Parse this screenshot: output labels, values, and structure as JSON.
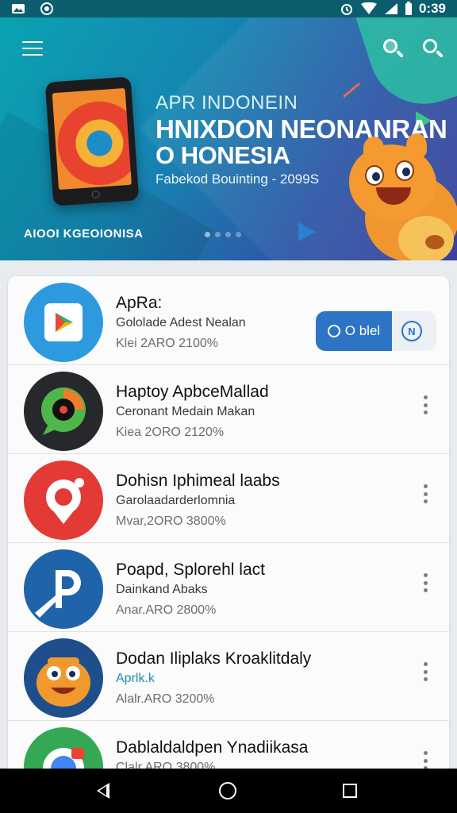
{
  "status_bar": {
    "time": "0:39",
    "icons": [
      "photo-icon",
      "circle-dot-icon",
      "alarm-icon",
      "wifi-icon",
      "signal-icon",
      "battery-icon"
    ]
  },
  "hero": {
    "kicker": "APR INDONEIN",
    "title_line1": "HNIXDON NEONANRAN",
    "title_line2": "O HONESIA",
    "subtitle": "Fabekod Bouinting - 2099S",
    "footer": "AIOOI KGEOIONISA",
    "carousel": {
      "count": 4,
      "active_index": 0
    },
    "colors": {
      "gradient_start": "#0aa3b1",
      "gradient_end": "#3b3f9b"
    }
  },
  "apps": [
    {
      "title": "ApRa:",
      "developer": "Gololade Adest Nealan",
      "meta": "Klei 2ARO 2100%",
      "icon": "play-store-icon",
      "action": {
        "install_label": "O blel",
        "alt_label": "N"
      }
    },
    {
      "title": "Haptoy ApbceMallad",
      "developer": "Ceronant Medain Makan",
      "meta": "Kiea 2ORO 2120%",
      "icon": "chat-bubble-icon"
    },
    {
      "title": "Dohisn Iphimeal laabs",
      "developer": "Garolaadarderlomnia",
      "meta": "Mvar,2ORO 3800%",
      "icon": "location-pin-icon"
    },
    {
      "title": "Poapd, Splorehl lact",
      "developer": "Dainkand Abaks",
      "meta": "Anar.ARO 2800%",
      "icon": "parking-icon"
    },
    {
      "title": "Dodan Iliplaks Kroaklitdaly",
      "developer": "Aprlk.k",
      "meta": "Alalr.ARO 3200%",
      "icon": "monster-mascot-icon"
    },
    {
      "title": "Dablaldaldpen Ynadiikasa",
      "developer": "",
      "meta": "Clalr.ARO 3800%",
      "icon": "maps-camera-icon"
    }
  ],
  "accent_color": "#2d74c6",
  "nav_bar": {
    "icons": [
      "back-icon",
      "home-icon",
      "recents-icon"
    ]
  }
}
